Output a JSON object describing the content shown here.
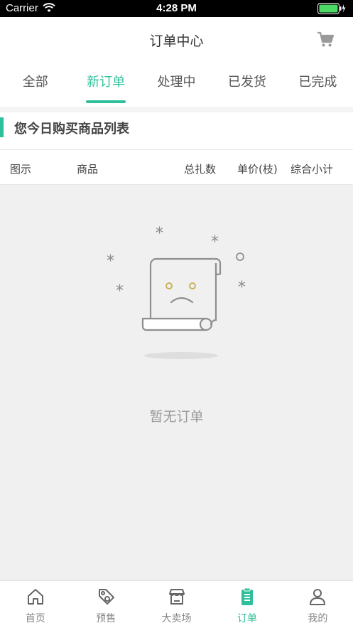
{
  "status_bar": {
    "carrier": "Carrier",
    "time": "4:28 PM"
  },
  "nav": {
    "title": "订单中心",
    "cart_icon": "cart-icon"
  },
  "tabs": [
    {
      "label": "全部",
      "active": false
    },
    {
      "label": "新订单",
      "active": true
    },
    {
      "label": "处理中",
      "active": false
    },
    {
      "label": "已发货",
      "active": false
    },
    {
      "label": "已完成",
      "active": false
    }
  ],
  "section": {
    "title": "您今日购买商品列表"
  },
  "table": {
    "columns": [
      "图示",
      "商品",
      "总扎数",
      "单价(枝)",
      "综合小计"
    ]
  },
  "empty": {
    "text": "暂无订单",
    "icon": "sad-document-icon"
  },
  "tab_bar": [
    {
      "label": "首页",
      "icon": "home-icon",
      "active": false
    },
    {
      "label": "预售",
      "icon": "tag-icon",
      "active": false
    },
    {
      "label": "大卖场",
      "icon": "store-icon",
      "active": false
    },
    {
      "label": "订单",
      "icon": "order-list-icon",
      "active": true
    },
    {
      "label": "我的",
      "icon": "user-icon",
      "active": false
    }
  ],
  "colors": {
    "accent": "#2fbf9a",
    "background": "#f0f0f0"
  }
}
